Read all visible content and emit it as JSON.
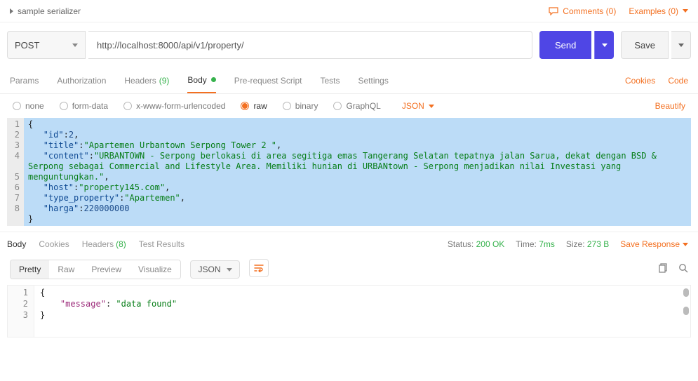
{
  "header": {
    "tab_title": "sample serializer",
    "comments_label": "Comments (0)",
    "examples_label": "Examples (0)"
  },
  "request": {
    "method": "POST",
    "url": "http://localhost:8000/api/v1/property/",
    "send_label": "Send",
    "save_label": "Save"
  },
  "tabs": {
    "params": "Params",
    "authorization": "Authorization",
    "headers": "Headers",
    "headers_count": "(9)",
    "body": "Body",
    "prerequest": "Pre-request Script",
    "tests": "Tests",
    "settings": "Settings",
    "cookies": "Cookies",
    "code": "Code"
  },
  "body_types": {
    "none": "none",
    "formdata": "form-data",
    "xwww": "x-www-form-urlencoded",
    "raw": "raw",
    "binary": "binary",
    "graphql": "GraphQL",
    "format": "JSON",
    "beautify": "Beautify"
  },
  "request_body": {
    "id_key": "\"id\"",
    "id_val": "2",
    "title_key": "\"title\"",
    "title_val": "\"Apartemen Urbantown Serpong Tower 2 \"",
    "content_key": "\"content\"",
    "content_val": "\"URBANTOWN - Serpong berlokasi di area segitiga emas Tangerang Selatan tepatnya jalan Sarua, dekat dengan BSD & Serpong sebagai Commercial and Lifestyle Area. Memiliki hunian di URBANtown - Serpong menjadikan nilai Investasi yang menguntungkan.\"",
    "host_key": "\"host\"",
    "host_val": "\"property145.com\"",
    "type_key": "\"type_property\"",
    "type_val": "\"Apartemen\"",
    "harga_key": "\"harga\"",
    "harga_val": "220000000"
  },
  "response": {
    "tabs": {
      "body": "Body",
      "cookies": "Cookies",
      "headers": "Headers",
      "headers_count": "(8)",
      "test_results": "Test Results"
    },
    "status_label": "Status:",
    "status_value": "200 OK",
    "time_label": "Time:",
    "time_value": "7ms",
    "size_label": "Size:",
    "size_value": "273 B",
    "save_response": "Save Response",
    "views": {
      "pretty": "Pretty",
      "raw": "Raw",
      "preview": "Preview",
      "visualize": "Visualize",
      "format": "JSON"
    },
    "body": {
      "msg_key": "\"message\"",
      "msg_val": "\"data found\""
    }
  }
}
